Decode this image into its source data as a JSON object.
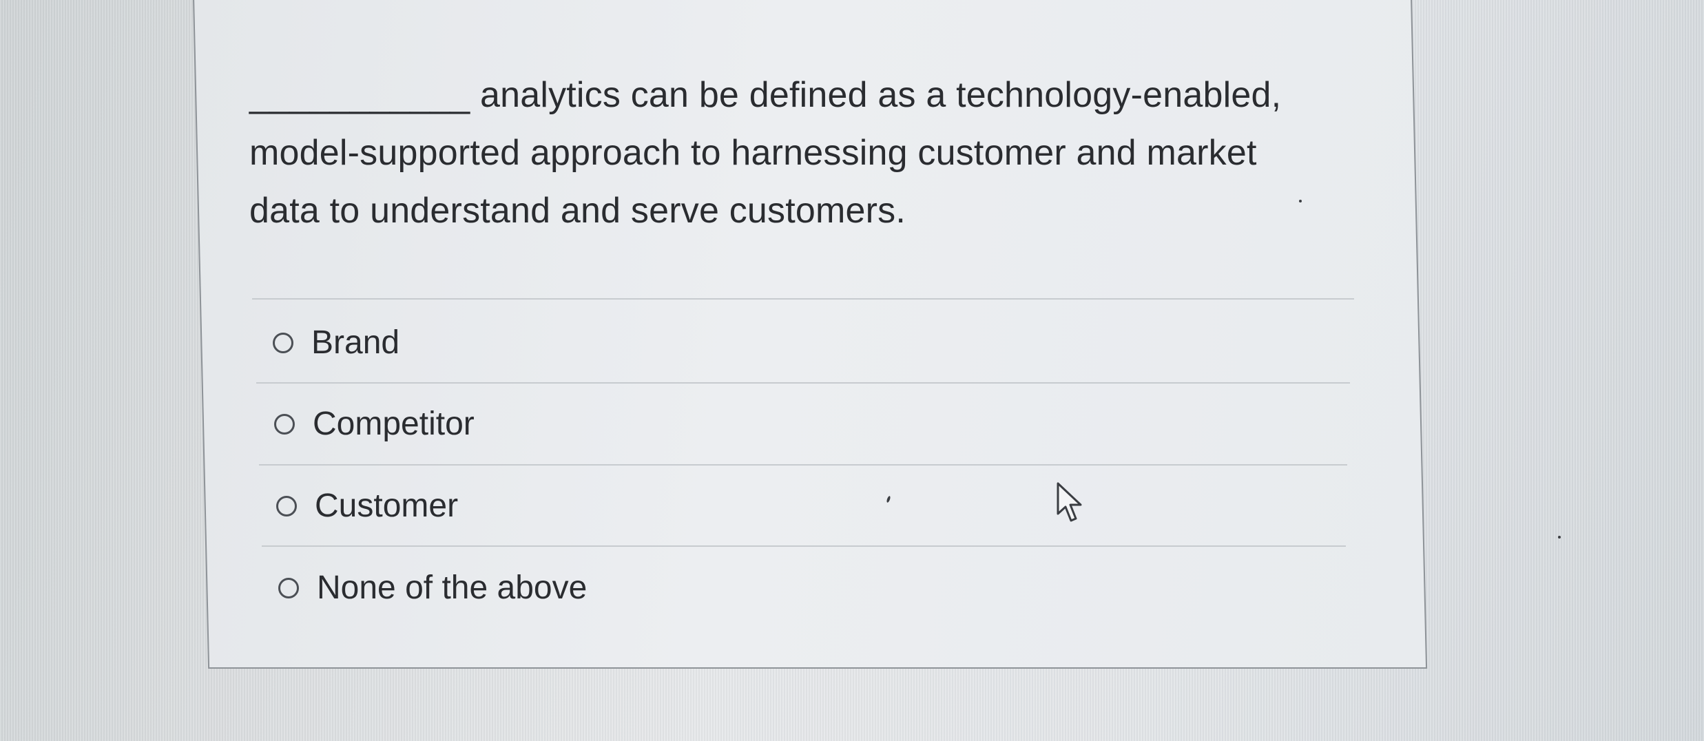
{
  "question": {
    "line1": "___________ analytics can be defined as a technology-enabled,",
    "line2": "model-supported approach to harnessing customer and market",
    "line3": "data to understand and serve customers."
  },
  "options": [
    {
      "label": "Brand",
      "selected": false
    },
    {
      "label": "Competitor",
      "selected": false
    },
    {
      "label": "Customer",
      "selected": false
    },
    {
      "label": "None of the above",
      "selected": false
    }
  ],
  "icons": {
    "radio": "radio-button-icon",
    "cursor": "mouse-pointer-icon"
  },
  "colors": {
    "text": "#2a2c30",
    "border": "#8e9398",
    "separator": "#c7cbcf"
  }
}
